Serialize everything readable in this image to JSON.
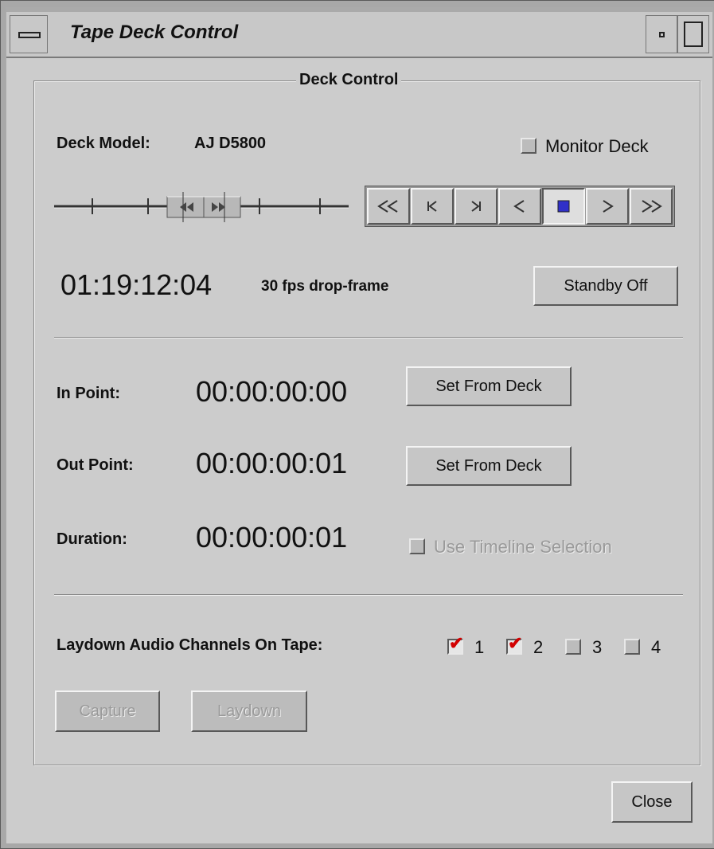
{
  "window": {
    "title": "Tape Deck Control"
  },
  "group": {
    "title": "Deck Control"
  },
  "deck": {
    "model_label": "Deck Model:",
    "model_value": "AJ D5800",
    "monitor_label": "Monitor Deck",
    "monitor_checked": false
  },
  "transport": {
    "buttons": [
      "rewind",
      "previous-frame",
      "next-frame",
      "play-reverse",
      "stop",
      "play",
      "fast-forward"
    ],
    "active": "stop",
    "stop_color": "#3030c8"
  },
  "timecode": {
    "current": "01:19:12:04",
    "format": "30 fps drop-frame",
    "standby_label": "Standby Off"
  },
  "points": {
    "in_label": "In Point:",
    "in_value": "00:00:00:00",
    "out_label": "Out Point:",
    "out_value": "00:00:00:01",
    "duration_label": "Duration:",
    "duration_value": "00:00:00:01",
    "set_from_deck": "Set From Deck",
    "use_timeline_label": "Use Timeline Selection",
    "use_timeline_checked": false,
    "use_timeline_enabled": false
  },
  "audio": {
    "label": "Laydown Audio Channels On Tape:",
    "channels": [
      {
        "label": "1",
        "checked": true
      },
      {
        "label": "2",
        "checked": true
      },
      {
        "label": "3",
        "checked": false
      },
      {
        "label": "4",
        "checked": false
      }
    ],
    "check_color": "#d20000"
  },
  "actions": {
    "capture": "Capture",
    "laydown": "Laydown",
    "capture_enabled": false,
    "laydown_enabled": false,
    "close": "Close"
  }
}
